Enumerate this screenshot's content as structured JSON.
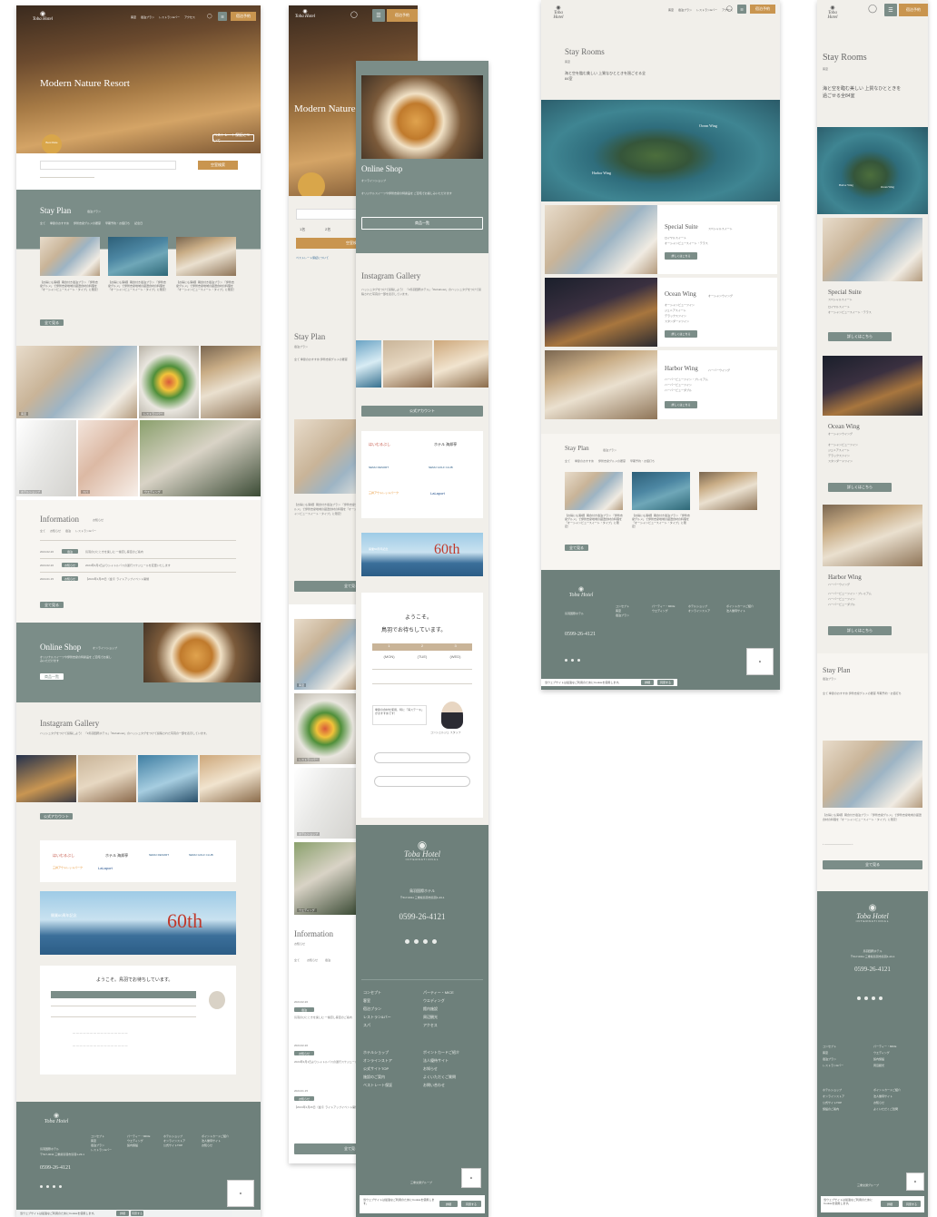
{
  "brand": {
    "logo_script": "Toba Hotel",
    "logo_sub": "INTERNATIONAL",
    "name_jp": "鳥羽国際ホテル",
    "address": "〒517-0011 三重県鳥羽市鳥羽1-23-1",
    "tel": "0599-26-4121"
  },
  "header": {
    "nav": [
      "客室",
      "宿泊プラン",
      "レストラン&バー",
      "アクセス"
    ],
    "reserve_label": "宿泊予約"
  },
  "hero": {
    "tagline": "Modern Nature Resort",
    "badge_top": "Best Rate",
    "badge_sub": "公式サイト限定特典",
    "plan_link": "ベストレート保証について",
    "search_button": "空室検索",
    "date1": "1名",
    "date2": "2名"
  },
  "stay_plan": {
    "title": "Stay Plan",
    "subtitle": "宿泊プラン",
    "filters": [
      "全て",
      "季節のおすすめ",
      "伊勢志摩グルメの饗宴",
      "早期予約・お値打ち",
      "記念日",
      "プレミアム・夏休み",
      "癒し・リラックス",
      "ルームプラン"
    ],
    "plan_text": "【お得にも満喫】朝食付き宿泊プラン 「伊勢志摩グルメ」で伊勢志摩地域の厳選食材の料理を「オーシャンビュースイート・タイプ」に限定！",
    "view_all": "全て見る"
  },
  "photo_tags": [
    "客室",
    "レストランバー",
    "スパ",
    "ホテルショップ",
    "ウエディング"
  ],
  "information": {
    "title": "Information",
    "subtitle": "お知らせ",
    "tabs": [
      "全て",
      "お知らせ",
      "宿泊",
      "レストラン&バー",
      "スパ",
      "ウエディング",
      "ショップ"
    ],
    "items": [
      {
        "date": "2024.02.26",
        "cat": "宿泊",
        "text": "鳥羽のひとときを楽しむ 一棟貸し客室のご案内"
      },
      {
        "date": "2024.02.20",
        "cat": "お知らせ",
        "text": "2024年3月1日よりシャトルバスの運行スケジュールを変更いたします"
      },
      {
        "date": "2024.01.15",
        "cat": "お知らせ",
        "text": "【2024年1月26日（金）】ライトアップイベント開催"
      }
    ],
    "view_all": "全て見る"
  },
  "online_shop": {
    "title": "Online Shop",
    "subtitle": "オンラインショップ",
    "desc": "オリジナルスイーツや伊勢志摩の特産品を ご自宅でお楽しみいただけます",
    "button": "商品一覧"
  },
  "instagram": {
    "title": "Instagram Gallery",
    "desc": "ハッシュタグをつけて投稿しよう！ 「#鳥羽国際ホテル」「#tobahotel」のハッシュタグをつけて投稿された写真の一部を表示しています。",
    "button": "公式アカウント"
  },
  "partners": [
    "はいむるぶし",
    "ホテル 海邦亭",
    "NEMU RESORT",
    "NEMU GOLF CLUB",
    "三井アウトレットパーク",
    "LaLaport"
  ],
  "anniversary": {
    "text": "開業60周年記念",
    "number": "60th"
  },
  "welcome": {
    "line1": "ようこそ。",
    "line2": "鳥羽でお待ちしています。",
    "days": [
      "1",
      "2",
      "3"
    ],
    "dows": [
      "(MON)",
      "(TUE)",
      "(WED)"
    ],
    "staff_msg": "季節の食材を使用、特に「海ステーキ」がおすすめです！",
    "staff_name": "コンシェルジュ スタッフ"
  },
  "stay_rooms": {
    "title": "Stay Rooms",
    "subtitle": "客室",
    "lead": "海と空を臨む美しい 上質なひとときを過ごせる全84室",
    "map_labels": [
      "Ocean Wing",
      "Harbor Wing"
    ],
    "rooms": [
      {
        "name": "Special Suite",
        "sub": "スペシャルスイート",
        "features": [
          "ロイヤルスイート",
          "オーシャンビュースイート・テラス"
        ],
        "button": "詳しくはこちら"
      },
      {
        "name": "Ocean Wing",
        "sub": "オーシャンウイング",
        "features": [
          "オーシャンビューツイン",
          "ジュニアスイート",
          "デラックスツイン",
          "スタンダードツイン"
        ],
        "button": "詳しくはこちら"
      },
      {
        "name": "Harbor Wing",
        "sub": "ハーバーウイング",
        "features": [
          "ハーバービューツイン・プレミアム",
          "ハーバービューツイン",
          "ハーバービューダブル"
        ],
        "button": "詳しくはこちら"
      }
    ]
  },
  "footer": {
    "links_a": [
      "コンセプト",
      "客室",
      "宿泊プラン",
      "レストラン&バー",
      "スパ"
    ],
    "links_b": [
      "パーティー・MICE",
      "ウエディング",
      "館内施設",
      "周辺観光",
      "アクセス"
    ],
    "links_c": [
      "ホテルショップ",
      "オンラインストア",
      "公式サイトTOP",
      "施設のご案内",
      "ベストレート保証"
    ],
    "links_d": [
      "ポイントカードご紹介",
      "法人優待サイト",
      "お知らせ",
      "よくいただくご質問",
      "お問い合わせ"
    ],
    "group": "三重交通グループ",
    "cookie": "当ウェブサイトは最適なご利用のためにCookieを使用します。",
    "cookie_btn1": "詳細",
    "cookie_btn2": "同意する"
  },
  "colors": {
    "sage": "#7b8d88",
    "sage_dark": "#6e807b",
    "gold": "#c9954f",
    "bg": "#f1efea"
  }
}
